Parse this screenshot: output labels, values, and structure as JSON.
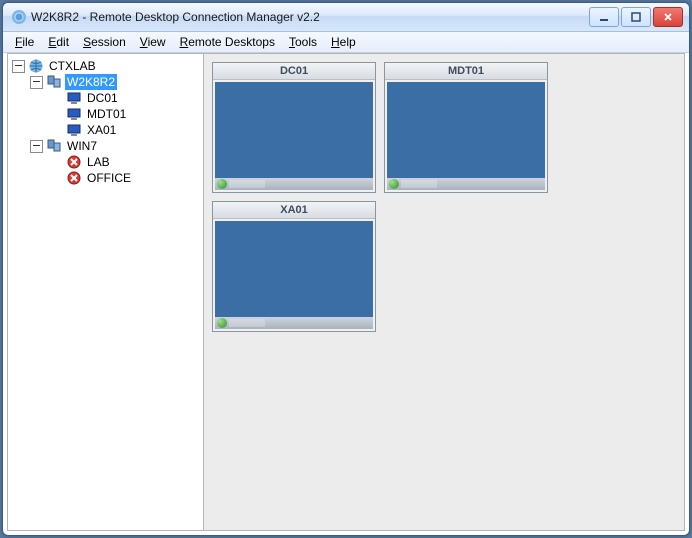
{
  "window": {
    "title": "W2K8R2 - Remote Desktop Connection Manager v2.2"
  },
  "menu": {
    "file": {
      "label": "File",
      "ul": "F"
    },
    "edit": {
      "label": "Edit",
      "ul": "E"
    },
    "session": {
      "label": "Session",
      "ul": "S"
    },
    "view": {
      "label": "View",
      "ul": "V"
    },
    "remote": {
      "label": "Remote Desktops",
      "ul": "R"
    },
    "tools": {
      "label": "Tools",
      "ul": "T"
    },
    "help": {
      "label": "Help",
      "ul": "H"
    }
  },
  "tree": {
    "root": {
      "label": "CTXLAB"
    },
    "group_w2k8r2": {
      "label": "W2K8R2"
    },
    "w2k8r2_dc01": {
      "label": "DC01"
    },
    "w2k8r2_mdt01": {
      "label": "MDT01"
    },
    "w2k8r2_xa01": {
      "label": "XA01"
    },
    "group_win7": {
      "label": "WIN7"
    },
    "win7_lab": {
      "label": "LAB"
    },
    "win7_office": {
      "label": "OFFICE"
    }
  },
  "thumbnails": {
    "t0": {
      "label": "DC01"
    },
    "t1": {
      "label": "MDT01"
    },
    "t2": {
      "label": "XA01"
    }
  }
}
